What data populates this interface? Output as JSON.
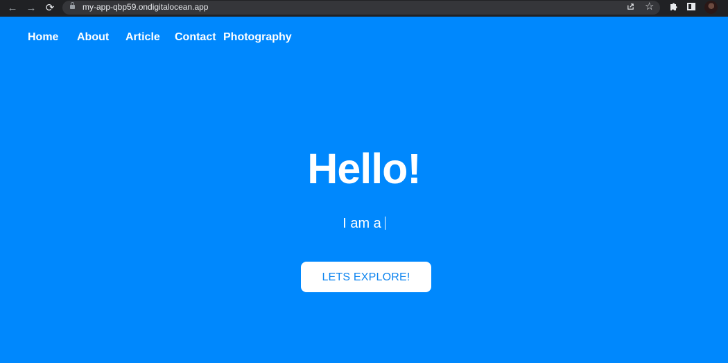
{
  "browser": {
    "url": "my-app-qbp59.ondigitalocean.app"
  },
  "nav": {
    "items": [
      "Home",
      "About",
      "Article",
      "Contact",
      "Photography"
    ]
  },
  "hero": {
    "title": "Hello!",
    "subtitle": "I am a",
    "button_label": "LETS EXPLORE!"
  },
  "colors": {
    "background": "#0088fd",
    "button_text": "#0b83ef",
    "browser_chrome": "#202124"
  },
  "icons": [
    "back-arrow-icon",
    "forward-arrow-icon",
    "reload-icon",
    "lock-icon",
    "share-icon",
    "star-icon",
    "extensions-icon",
    "side-panel-icon",
    "avatar"
  ]
}
